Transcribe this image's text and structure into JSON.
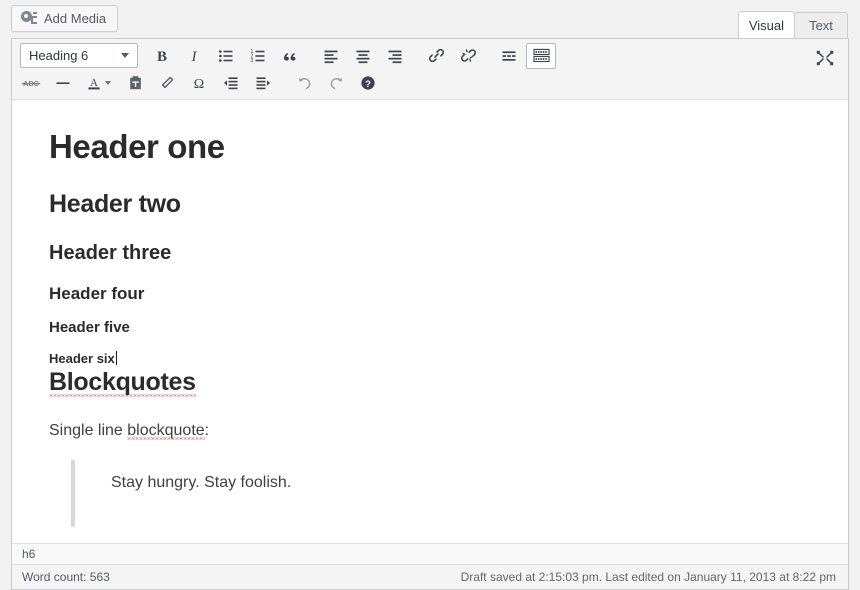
{
  "topbar": {
    "add_media_label": "Add Media",
    "tabs": [
      {
        "label": "Visual",
        "active": true
      },
      {
        "label": "Text",
        "active": false
      }
    ]
  },
  "toolbar": {
    "format_select_value": "Heading 6",
    "row1": [
      {
        "name": "bold-icon",
        "title": "Bold"
      },
      {
        "name": "italic-icon",
        "title": "Italic"
      },
      {
        "name": "bulleted-list-icon",
        "title": "Bulleted list"
      },
      {
        "name": "numbered-list-icon",
        "title": "Numbered list"
      },
      {
        "name": "blockquote-icon",
        "title": "Blockquote"
      },
      {
        "name": "align-left-icon",
        "title": "Align left"
      },
      {
        "name": "align-center-icon",
        "title": "Align center"
      },
      {
        "name": "align-right-icon",
        "title": "Align right"
      },
      {
        "name": "link-icon",
        "title": "Insert/edit link"
      },
      {
        "name": "unlink-icon",
        "title": "Remove link"
      },
      {
        "name": "read-more-icon",
        "title": "Insert Read More tag"
      },
      {
        "name": "toolbar-toggle-icon",
        "title": "Toolbar Toggle"
      }
    ],
    "row2": [
      {
        "name": "strikethrough-icon",
        "title": "Strikethrough"
      },
      {
        "name": "horizontal-rule-icon",
        "title": "Horizontal line"
      },
      {
        "name": "text-color-icon",
        "title": "Text color"
      },
      {
        "name": "paste-as-text-icon",
        "title": "Paste as text"
      },
      {
        "name": "clear-formatting-icon",
        "title": "Clear formatting"
      },
      {
        "name": "special-character-icon",
        "title": "Special character"
      },
      {
        "name": "outdent-icon",
        "title": "Decrease indent"
      },
      {
        "name": "indent-icon",
        "title": "Increase indent"
      },
      {
        "name": "undo-icon",
        "title": "Undo"
      },
      {
        "name": "redo-icon",
        "title": "Redo"
      },
      {
        "name": "help-icon",
        "title": "Keyboard Shortcuts"
      }
    ],
    "fullscreen_title": "Distraction-free writing mode"
  },
  "content": {
    "header_one": "Header one",
    "header_two": "Header two",
    "header_three": "Header three",
    "header_four": "Header four",
    "header_five": "Header five",
    "header_six": "Header six",
    "blockquotes_heading": "Blockquotes",
    "single_line_prefix": "Single line ",
    "single_line_misspelled": "blockquote",
    "single_line_suffix": ":",
    "blockquote_text": "Stay hungry. Stay foolish."
  },
  "statusbar": {
    "element_path": "h6",
    "word_count": "Word count: 563",
    "save_status": "Draft saved at 2:15:03 pm. Last edited on January 11, 2013 at 8:22 pm"
  },
  "colors": {
    "chrome_bg": "#f1f1f1",
    "toolbar_bg": "#f4f4f4",
    "border": "#cccccc",
    "text": "#555d66",
    "heading": "#2b2b2b",
    "spellcheck": "#dd3333",
    "blockquote_bar": "#d8d8d8"
  }
}
